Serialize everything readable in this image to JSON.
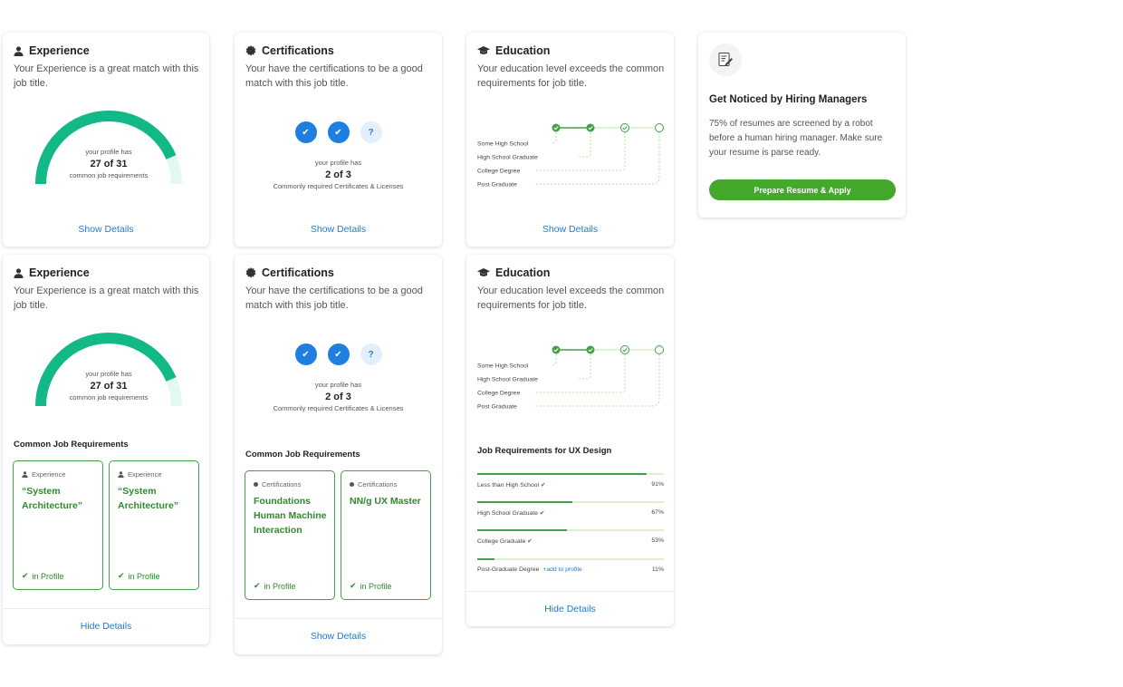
{
  "experience": {
    "title": "Experience",
    "desc": "Your Experience is a great match with this job title.",
    "profile_has": "your profile has",
    "count": "27 of 31",
    "count_value": 27,
    "count_total": 31,
    "sub": "common job requirements",
    "link": "Show Details",
    "link_expanded": "Hide Details",
    "req_title": "Common Job Requirements",
    "reqs": [
      {
        "category": "Experience",
        "name": "“System Architecture”",
        "status": "in Profile"
      },
      {
        "category": "Experience",
        "name": "“System Architecture”",
        "status": "in Profile"
      }
    ]
  },
  "certifications": {
    "title": "Certifications",
    "desc": "Your have the certifications to be a good match with this job title.",
    "icons": [
      "check-icon",
      "check-icon",
      "question-icon"
    ],
    "question_mark": "?",
    "profile_has": "your profile has",
    "count": "2 of 3",
    "sub": "Commonly required Certificates & Licenses",
    "link": "Show Details",
    "req_title": "Common Job Requirements",
    "reqs": [
      {
        "category": "Certifications",
        "name": "Foundations Human Machine Interaction",
        "status": "in Profile"
      },
      {
        "category": "Certifications",
        "name": "NN/g UX Master",
        "status": "in Profile"
      }
    ]
  },
  "education": {
    "title": "Education",
    "desc": "Your education level exceeds the common requirements for job title.",
    "levels": [
      "Some High School",
      "High School Graduate",
      "College Degree",
      "Post Graduate"
    ],
    "link": "Show Details",
    "link_expanded": "Hide Details",
    "req_title": "Job Requirements for UX Design",
    "bars": [
      {
        "label": "Less than High School",
        "pct": "91%",
        "value": 0.91,
        "in_profile": true
      },
      {
        "label": "High School Graduate",
        "pct": "67%",
        "value": 0.51,
        "in_profile": true
      },
      {
        "label": "College Graduate",
        "pct": "53%",
        "value": 0.48,
        "in_profile": true
      },
      {
        "label": "Post-Graduate Degree",
        "pct": "11%",
        "value": 0.09,
        "in_profile": false,
        "add": "+add to profile"
      }
    ]
  },
  "notice": {
    "icon": "document-edit-icon",
    "title": "Get Noticed by Hiring Managers",
    "desc": "75% of resumes are screened by a robot before a human hiring manager. Make sure your resume is parse ready.",
    "button": "Prepare Resume & Apply"
  },
  "colors": {
    "gauge": "#12b886",
    "gauge_track": "#e3f8f1",
    "accent_blue": "#1e7fe0",
    "link": "#1f7ad1",
    "green": "#43a047",
    "cta": "#43a82b"
  }
}
